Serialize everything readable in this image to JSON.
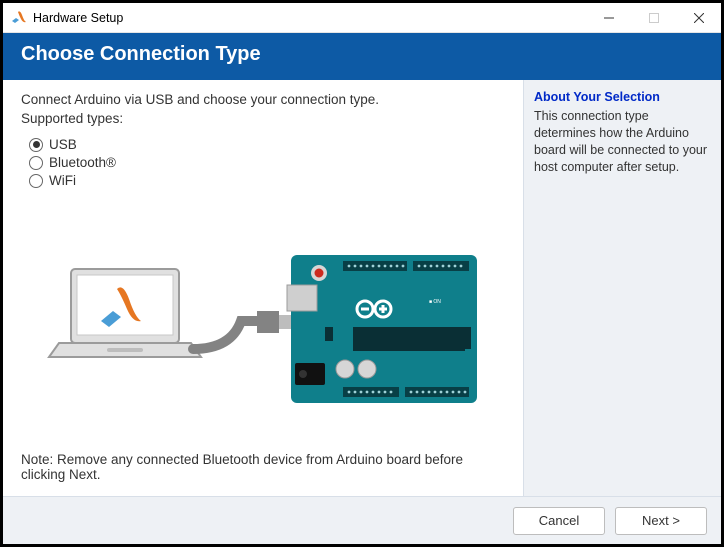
{
  "window": {
    "title": "Hardware Setup"
  },
  "header": {
    "title": "Choose Connection Type"
  },
  "main": {
    "intro": "Connect Arduino via USB and choose your connection type.",
    "supported_label": "Supported types:",
    "options": {
      "usb": "USB",
      "bluetooth": "Bluetooth®",
      "wifi": "WiFi"
    },
    "selected": "usb",
    "note": "Note: Remove any connected Bluetooth device from Arduino board before clicking Next."
  },
  "side": {
    "title": "About Your Selection",
    "text": "This connection type determines how the Arduino board will be connected to your host computer after setup."
  },
  "footer": {
    "cancel": "Cancel",
    "next": "Next >"
  }
}
